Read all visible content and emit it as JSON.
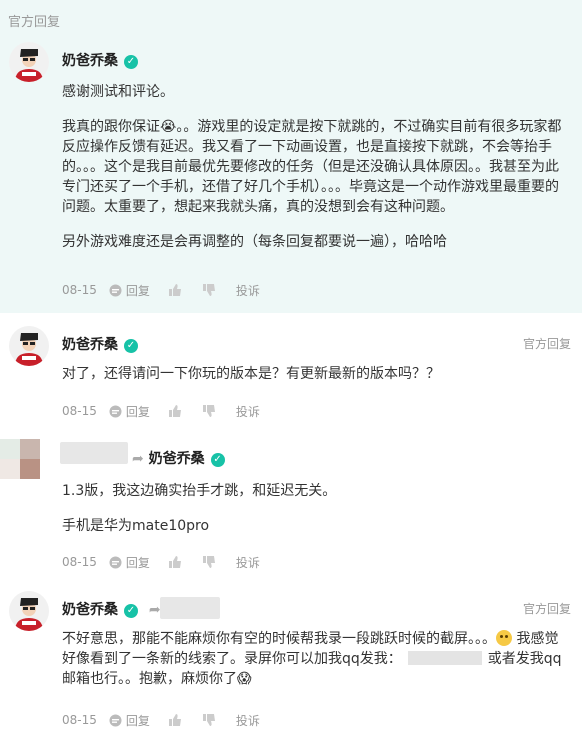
{
  "section": {
    "label": "官方回复"
  },
  "comments": [
    {
      "author": "奶爸乔桑",
      "paragraphs": [
        "感谢测试和评论。",
        "我真的跟你保证😭。。游戏里的设定就是按下就跳的，不过确实目前有很多玩家都反应操作反馈有延迟。我又看了一下动画设置，也是直接按下就跳，不会等抬手的。。。这个是我目前最优先要修改的任务（但是还没确认具体原因。。我甚至为此专门还买了一个手机，还借了好几个手机）。。。毕竟这是一个动作游戏里最重要的问题。太重要了，想起来我就头痛，真的没想到会有这种问题。",
        "另外游戏难度还是会再调整的（每条回复都要说一遍），哈哈哈"
      ],
      "date": "08-15",
      "reply_label": "回复",
      "report_label": "投诉"
    },
    {
      "author": "奶爸乔桑",
      "tag": "官方回复",
      "paragraphs": [
        "对了，还得请问一下你玩的版本是？有更新最新的版本吗？？"
      ],
      "date": "08-15",
      "reply_label": "回复",
      "report_label": "投诉"
    },
    {
      "reply_to": "奶爸乔桑",
      "paragraphs": [
        "1.3版，我这边确实抬手才跳，和延迟无关。",
        "手机是华为mate10pro"
      ],
      "date": "08-15",
      "reply_label": "回复",
      "report_label": "投诉"
    },
    {
      "author": "奶爸乔桑",
      "tag": "官方回复",
      "text_a": "不好意思，那能不能麻烦你有空的时候帮我录一段跳跃时候的截屏。。。",
      "text_b": "我感觉好像看到了一条新的线索了。录屏你可以加我qq发我：",
      "text_c": "或者发我qq邮箱也行。。抱歉，麻烦你了😱",
      "date": "08-15",
      "reply_label": "回复",
      "report_label": "投诉"
    }
  ],
  "colors": {
    "highlight_bg": "#eef8f7",
    "verify": "#17c2a7",
    "muted": "#999999"
  },
  "icons": [
    "verified-icon",
    "reply-icon",
    "thumb-up-icon",
    "thumb-down-icon",
    "share-arrow-icon"
  ]
}
